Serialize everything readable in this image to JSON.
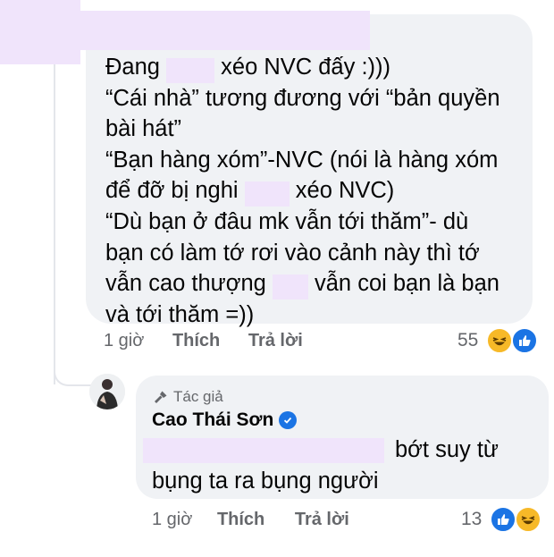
{
  "comment1": {
    "lines": [
      "Đang ",
      " xéo NVC đấy :)))",
      "“Cái nhà” tương đương với “bản quyền",
      "bài hát”",
      "“Bạn hàng xóm”-NVC (nói là hàng xóm",
      "để đỡ bị nghi ",
      " xéo NVC)",
      "“Dù bạn ở đâu mk vẫn tới thăm”- dù",
      "bạn có làm tớ rơi vào cảnh này thì tớ",
      "vẫn cao thượng ",
      " vẫn coi bạn là bạn",
      "và tới thăm =))"
    ],
    "time": "1 giờ",
    "like_label": "Thích",
    "reply_label": "Trả lời",
    "reaction_count": "55",
    "reactions": [
      "haha-icon",
      "like-icon"
    ]
  },
  "reply": {
    "author_tag": "Tác giả",
    "author_name": "Cao Thái Sơn",
    "lines": [
      "bớt suy từ",
      "bụng ta ra bụng người"
    ],
    "time": "1 giờ",
    "like_label": "Thích",
    "reply_label": "Trả lời",
    "reaction_count": "13",
    "reactions": [
      "like-icon",
      "haha-icon"
    ]
  },
  "colors": {
    "bubble": "#f0f2f5",
    "redaction": "#f0e4fb",
    "meta_text": "#65676b",
    "like_blue": "#1b74e4",
    "haha_yellow": "#f7b928"
  }
}
